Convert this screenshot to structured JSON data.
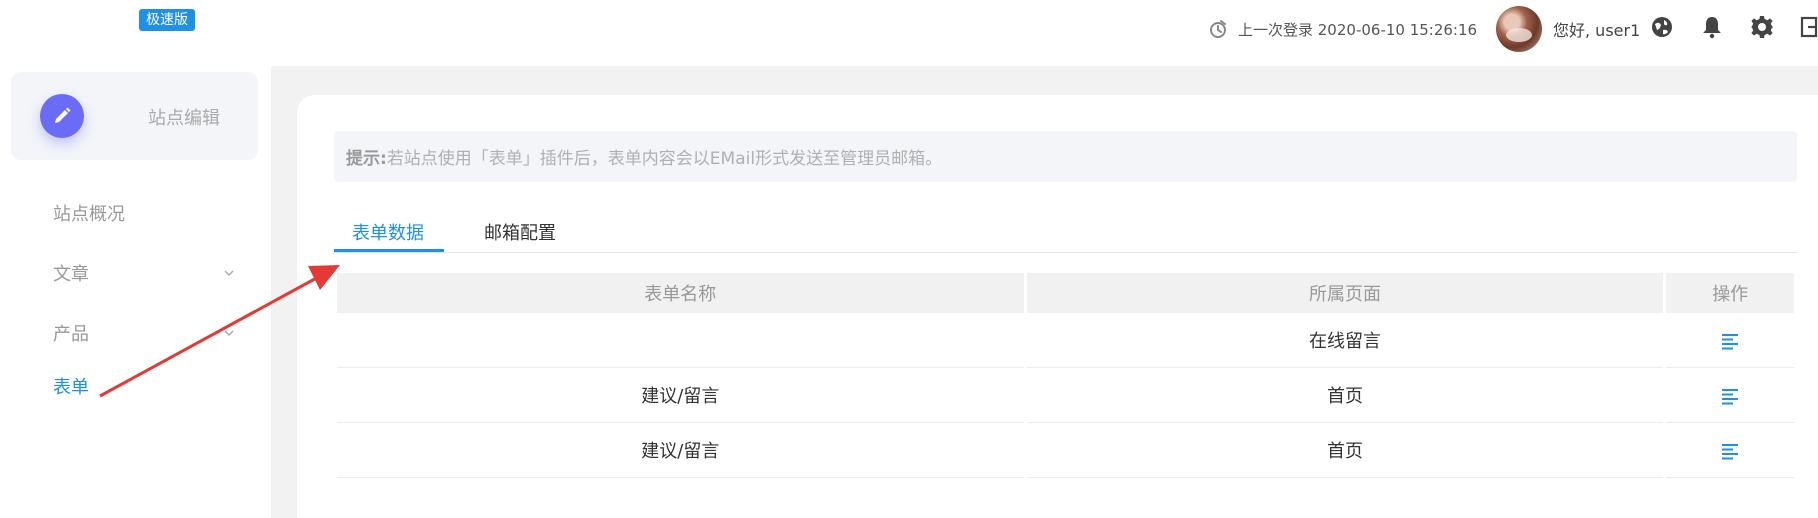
{
  "topbar": {
    "badge": "极速版",
    "last_login": "上一次登录 2020-06-10 15:26:16",
    "greeting": "您好, user1",
    "icons": [
      "clock-icon",
      "globe-icon",
      "bell-icon",
      "gear-icon",
      "exit-icon"
    ]
  },
  "sidebar": {
    "site_card_label": "站点编辑",
    "items": [
      {
        "label": "站点概况",
        "chevron": false
      },
      {
        "label": "文章",
        "chevron": true
      },
      {
        "label": "产品",
        "chevron": true
      },
      {
        "label": "表单",
        "chevron": false,
        "active": true
      }
    ]
  },
  "main": {
    "tip_label": "提示:",
    "tip_text": "若站点使用「表单」插件后，表单内容会以EMail形式发送至管理员邮箱。",
    "tabs": [
      {
        "label": "表单数据",
        "active": true
      },
      {
        "label": "邮箱配置",
        "active": false
      }
    ],
    "table": {
      "headers": [
        "表单名称",
        "所属页面",
        "操作"
      ],
      "rows": [
        {
          "name": "",
          "page": "在线留言",
          "highlight": false
        },
        {
          "name": "建议/留言",
          "page": "首页",
          "highlight": true
        },
        {
          "name": "建议/留言",
          "page": "首页",
          "highlight": false
        }
      ]
    }
  },
  "colors": {
    "accent": "#1e90e6",
    "badge": "#1e90e6",
    "edit_button": "#6b6cf6",
    "highlight_text": "#c0392b",
    "annotation_arrow": "#e53935"
  }
}
